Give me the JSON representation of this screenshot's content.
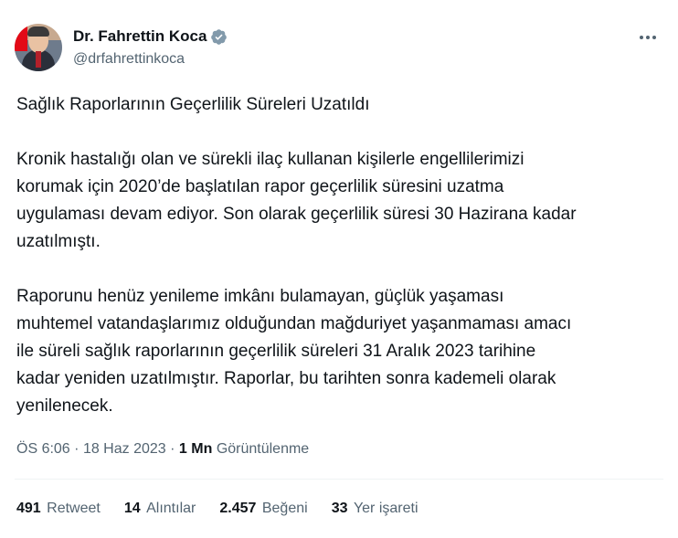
{
  "author": {
    "display_name": "Dr. Fahrettin Koca",
    "handle": "@drfahrettinkoca",
    "verified_icon": "verified-badge-icon",
    "verified_color": "#1d9bf0"
  },
  "more_icon": "more-dots-icon",
  "tweet": {
    "title": "Sağlık Raporlarının Geçerlilik Süreleri Uzatıldı",
    "paragraph_1_lines": [
      "Kronik hastalığı olan ve sürekli ilaç kullanan kişilerle engellilerimizi",
      "korumak için 2020’de başlatılan rapor geçerlilik süresini uzatma",
      "uygulaması devam ediyor. Son olarak geçerlilik süresi 30 Hazirana kadar",
      "uzatılmıştı."
    ],
    "paragraph_2_lines": [
      "Raporunu henüz yenileme imkânı bulamayan, güçlük yaşaması",
      "muhtemel vatandaşlarımız olduğundan mağduriyet yaşanmaması amacı",
      "ile süreli sağlık raporlarının geçerlilik süreleri 31 Aralık 2023 tarihine",
      "kadar yeniden uzatılmıştır. Raporlar, bu tarihten sonra kademeli olarak",
      "yenilenecek."
    ]
  },
  "meta": {
    "time": "ÖS 6:06",
    "separator": "·",
    "date": "18 Haz 2023",
    "views_count": "1 Mn",
    "views_label": "Görüntülenme"
  },
  "stats": [
    {
      "count": "491",
      "label": "Retweet"
    },
    {
      "count": "14",
      "label": "Alıntılar"
    },
    {
      "count": "2.457",
      "label": "Beğeni"
    },
    {
      "count": "33",
      "label": "Yer işareti"
    }
  ],
  "colors": {
    "text": "#0f1419",
    "secondary": "#536471",
    "divider": "#eff3f4"
  }
}
